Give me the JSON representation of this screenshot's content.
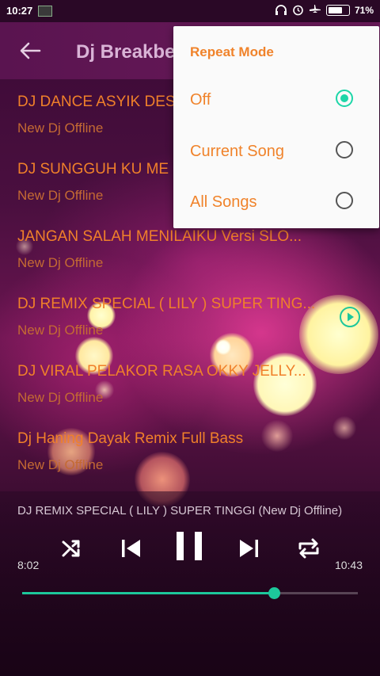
{
  "status_bar": {
    "time": "10:27",
    "battery": "71%"
  },
  "toolbar": {
    "title": "Dj Breakbe"
  },
  "songs": [
    {
      "title": "DJ DANCE ASYIK DES",
      "subtitle": "New Dj Offline"
    },
    {
      "title": "DJ SUNGGUH KU ME",
      "subtitle": "New Dj Offline"
    },
    {
      "title": "JANGAN SALAH MENILAIKU Versi SLO...",
      "subtitle": "New Dj Offline"
    },
    {
      "title": "DJ REMIX SPECIAL ( LILY ) SUPER TING...",
      "subtitle": "New Dj Offline"
    },
    {
      "title": "DJ VIRAL PELAKOR RASA OKKY JELLY...",
      "subtitle": "New Dj Offline"
    },
    {
      "title": "Dj Haning   Dayak Remix  Full Bass",
      "subtitle": "New Dj Offline"
    }
  ],
  "repeat_menu": {
    "title": "Repeat Mode",
    "options": [
      {
        "label": "Off",
        "selected": true
      },
      {
        "label": "Current Song",
        "selected": false
      },
      {
        "label": "All Songs",
        "selected": false
      }
    ]
  },
  "player": {
    "now_playing": "DJ REMIX SPECIAL ( LILY ) SUPER TINGGI (New Dj Offline)",
    "elapsed": "8:02",
    "duration": "10:43",
    "progress": 0.75
  },
  "colors": {
    "accent": "#1dc79b",
    "song_title": "#f0802a",
    "menu_text": "#f0832b"
  },
  "icons": {
    "back": "arrow-left-icon",
    "shuffle": "shuffle-icon",
    "previous": "skip-previous-icon",
    "pause": "pause-icon",
    "next": "skip-next-icon",
    "repeat": "repeat-icon",
    "playing": "play-circle-icon"
  }
}
